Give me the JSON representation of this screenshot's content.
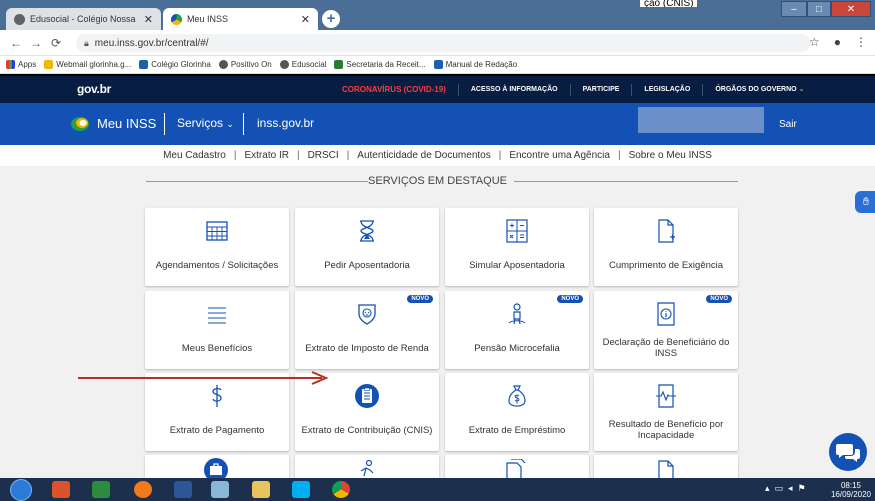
{
  "browser": {
    "tabs": [
      {
        "title": "Edusocial - Colégio Nossa Senhora",
        "active": false
      },
      {
        "title": "Meu INSS",
        "active": true
      }
    ],
    "url": "meu.inss.gov.br/central/#/",
    "top_right_text": "ção (CNIS)",
    "bookmarks": [
      "Apps",
      "Webmail glorinha.g...",
      "Colégio Glorinha",
      "Positivo On",
      "Edusocial",
      "Secretaria da Receit...",
      "Manual de Redação"
    ]
  },
  "gov": {
    "logo": "gov.br",
    "links": [
      "CORONAVÍRUS (COVID-19)",
      "ACESSO À INFORMAÇÃO",
      "PARTICIPE",
      "LEGISLAÇÃO",
      "ÓRGÃOS DO GOVERNO"
    ]
  },
  "inss": {
    "title": "Meu INSS",
    "servicos": "Serviços",
    "site": "inss.gov.br",
    "sair": "Sair"
  },
  "subnav": [
    "Meu Cadastro",
    "Extrato IR",
    "DRSCI",
    "Autenticidade de Documentos",
    "Encontre uma Agência",
    "Sobre o Meu INSS"
  ],
  "section_title": "SERVIÇOS EM DESTAQUE",
  "cards": [
    {
      "label": "Agendamentos / Solicitações",
      "icon": "calendar-icon",
      "badge": ""
    },
    {
      "label": "Pedir Aposentadoria",
      "icon": "hourglass-icon",
      "badge": ""
    },
    {
      "label": "Simular Aposentadoria",
      "icon": "calculator-icon",
      "badge": ""
    },
    {
      "label": "Cumprimento de Exigência",
      "icon": "document-add-icon",
      "badge": ""
    },
    {
      "label": "Meus Benefícios",
      "icon": "list-icon",
      "badge": ""
    },
    {
      "label": "Extrato de Imposto de Renda",
      "icon": "lion-shield-icon",
      "badge": "NOVO"
    },
    {
      "label": "Pensão Microcefalia",
      "icon": "person-icon",
      "badge": "NOVO"
    },
    {
      "label": "Declaração de Beneficiário do INSS",
      "icon": "info-document-icon",
      "badge": "NOVO"
    },
    {
      "label": "Extrato de Pagamento",
      "icon": "dollar-icon",
      "badge": ""
    },
    {
      "label": "Extrato de Contribuição (CNIS)",
      "icon": "clipboard-icon",
      "badge": ""
    },
    {
      "label": "Extrato de Empréstimo",
      "icon": "money-bag-icon",
      "badge": ""
    },
    {
      "label": "Resultado de Benefício por Incapacidade",
      "icon": "heartbeat-doc-icon",
      "badge": ""
    }
  ],
  "taskbar": {
    "time": "08:15",
    "date": "16/09/2020"
  },
  "colors": {
    "gov_bar": "#071d41",
    "inss_blue": "#1351b4",
    "covid_red": "#ff3b3b",
    "arrow_red": "#b5302a"
  }
}
